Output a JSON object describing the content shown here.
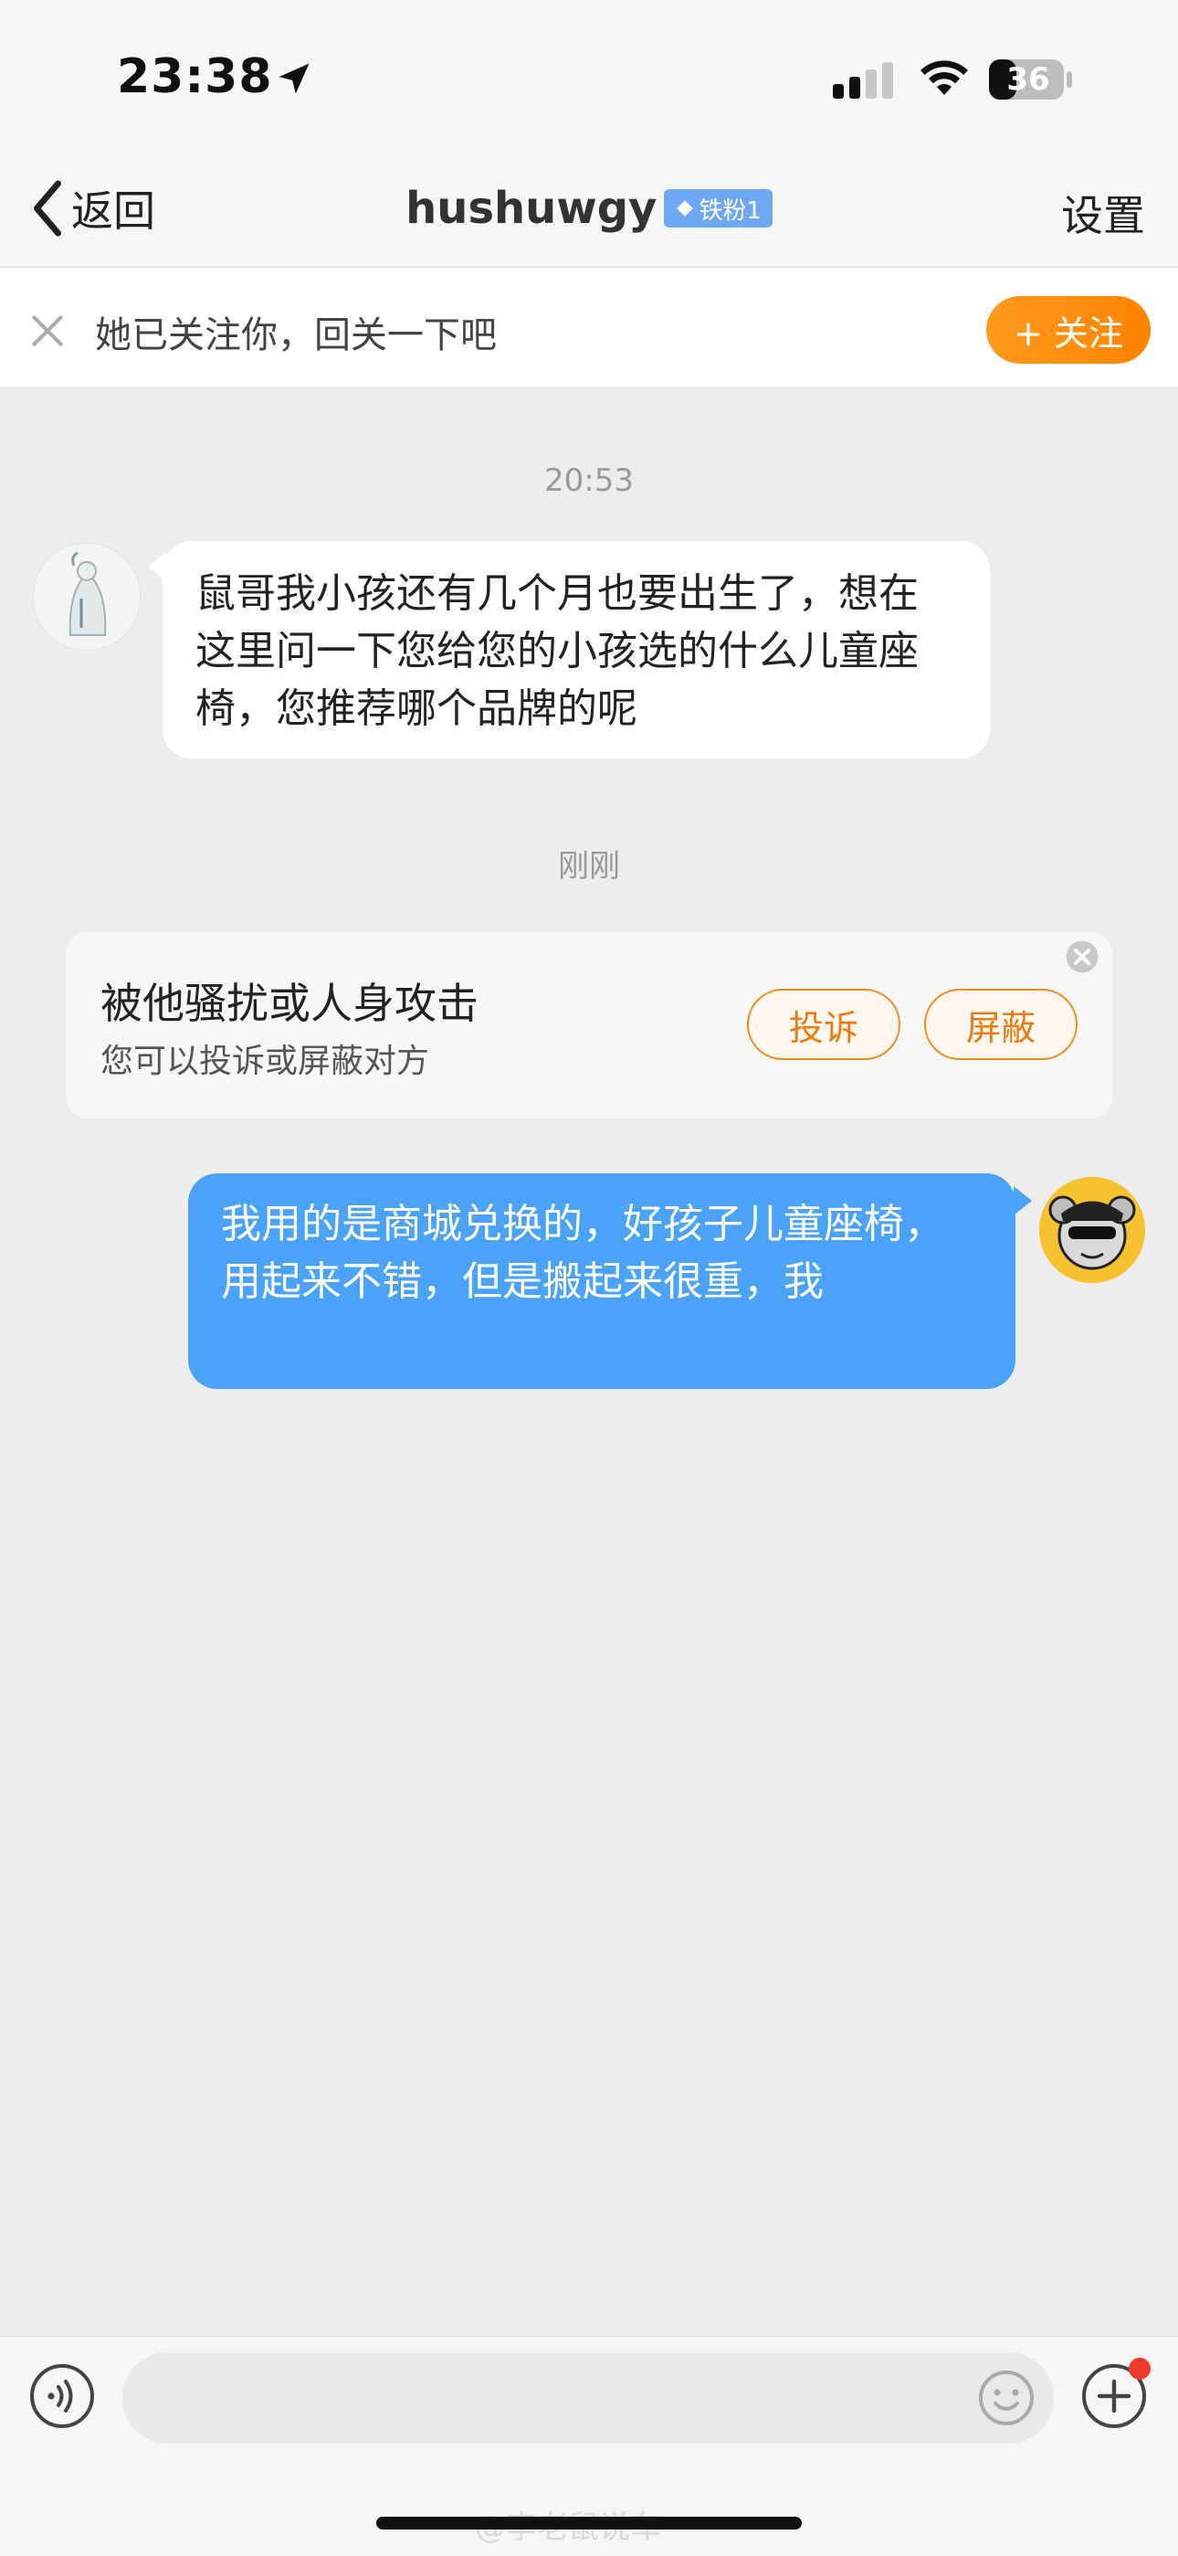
{
  "status_bar": {
    "time": "23:38",
    "battery": "36",
    "icons": [
      "location-arrow-icon",
      "cellular-signal-icon",
      "wifi-icon",
      "battery-icon"
    ]
  },
  "nav": {
    "back_label": "返回",
    "title": "hushuwgy",
    "badge": "铁粉1",
    "settings_label": "设置"
  },
  "follow_banner": {
    "text": "她已关注你，回关一下吧",
    "follow_label": "+ 关注"
  },
  "messages": {
    "timestamp1": "20:53",
    "incoming_text": "鼠哥我小孩还有几个月也要出生了，想在这里问一下您给您的小孩选的什么儿童座椅，您推荐哪个品牌的呢",
    "timestamp2": "刚刚",
    "outgoing_text": "我用的是商城兑换的，好孩子儿童座椅，用起来不错，但是搬起来很重，我"
  },
  "report_card": {
    "title": "被他骚扰或人身攻击",
    "description": "您可以投诉或屏蔽对方",
    "complain_label": "投诉",
    "block_label": "屏蔽"
  },
  "input_bar": {
    "placeholder": ""
  },
  "watermark": "@李老鼠说车",
  "colors": {
    "accent_orange": "#ff8a00",
    "bubble_blue": "#4aa3f6",
    "badge_blue": "#6fa8f2",
    "background": "#ededed"
  }
}
